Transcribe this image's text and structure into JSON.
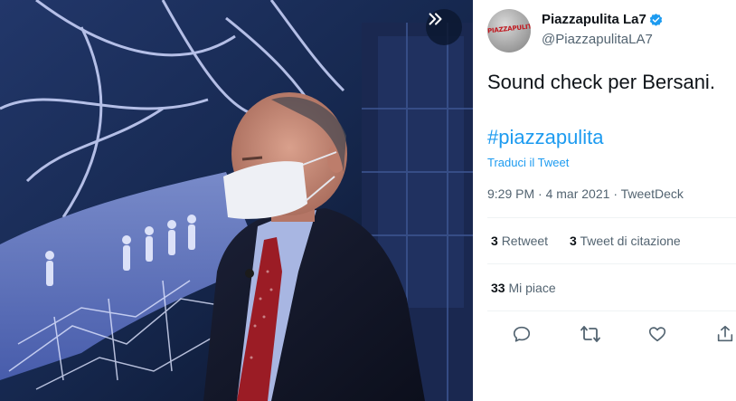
{
  "profile": {
    "name": "Piazzapulita La7",
    "handle": "@PiazzapulitaLA7",
    "avatar_text": "PIAZZAPULITA",
    "avatar_icon": "avatar",
    "verified_icon": "verified-badge-icon"
  },
  "tweet": {
    "text": "Sound check per Bersani.",
    "hashtag": "#piazzapulita",
    "translate": "Traduci il Tweet",
    "time": "9:29 PM",
    "separator": "·",
    "date": "4 mar 2021",
    "source": "TweetDeck"
  },
  "stats": {
    "retweets_count": "3",
    "retweets_label": "Retweet",
    "quotes_count": "3",
    "quotes_label": "Tweet di citazione",
    "likes_count": "33",
    "likes_label": "Mi piace"
  },
  "actions": [
    "reply-icon",
    "retweet-icon",
    "like-icon",
    "share-icon"
  ],
  "media": {
    "expand_icon": "chevrons-right-icon"
  },
  "colors": {
    "accent": "#1d9bf0",
    "text": "#0f1419",
    "muted": "#536471",
    "divider": "#eff3f4"
  }
}
